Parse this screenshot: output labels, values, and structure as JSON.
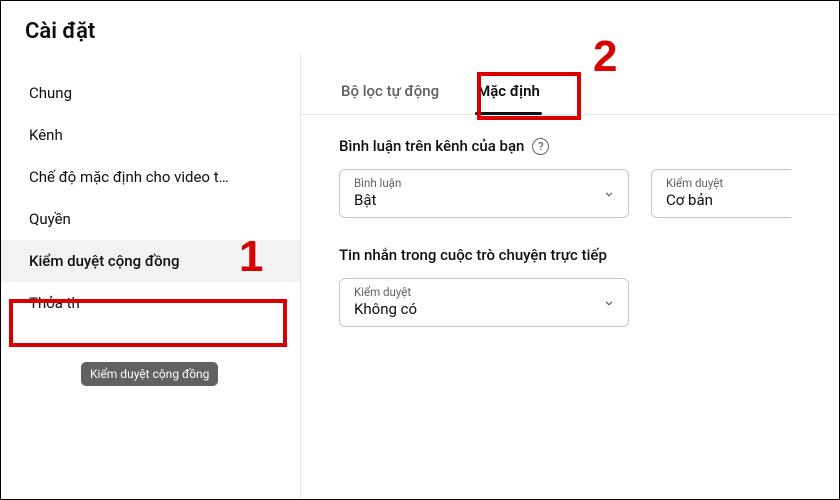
{
  "header": {
    "title": "Cài đặt"
  },
  "sidebar": {
    "items": [
      {
        "label": "Chung"
      },
      {
        "label": "Kênh"
      },
      {
        "label": "Chế độ mặc định cho video t…"
      },
      {
        "label": "Quyền"
      },
      {
        "label": "Kiểm duyệt cộng đồng"
      },
      {
        "label": "Thỏa th"
      }
    ],
    "tooltip": "Kiểm duyệt cộng đồng"
  },
  "annotations": {
    "callout1": "1",
    "callout2": "2"
  },
  "main": {
    "tabs": [
      {
        "label": "Bộ lọc tự động"
      },
      {
        "label": "Mặc định"
      }
    ],
    "commentsSection": {
      "title": "Bình luận trên kênh của bạn",
      "controls": [
        {
          "label": "Bình luận",
          "value": "Bật"
        },
        {
          "label": "Kiểm duyệt",
          "value": "Cơ bản"
        }
      ]
    },
    "chatSection": {
      "title": "Tin nhắn trong cuộc trò chuyện trực tiếp",
      "controls": [
        {
          "label": "Kiểm duyệt",
          "value": "Không có"
        }
      ]
    }
  }
}
